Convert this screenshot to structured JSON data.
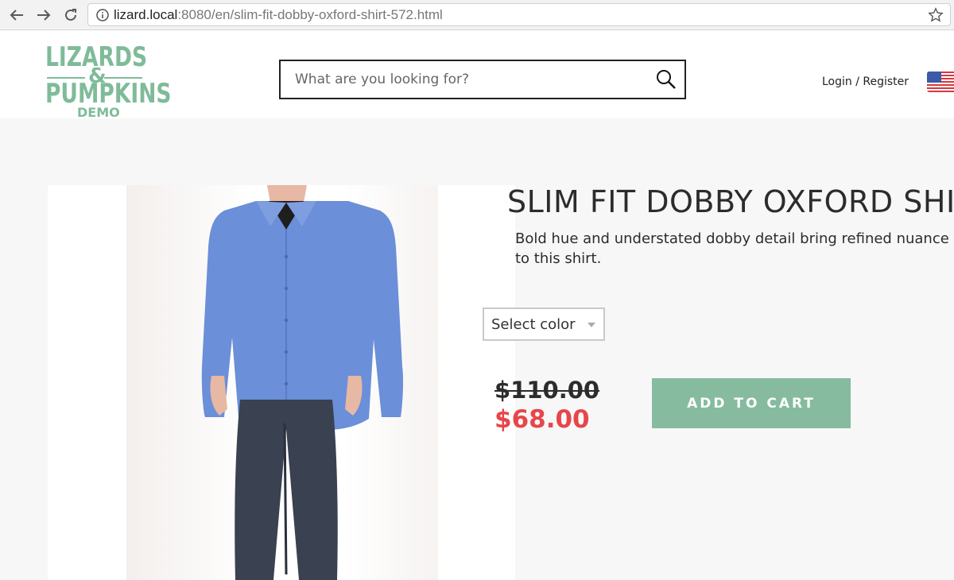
{
  "browser": {
    "url_host": "lizard.local",
    "url_rest": ":8080/en/slim-fit-dobby-oxford-shirt-572.html"
  },
  "header": {
    "logo": {
      "line1": "LIZARDS",
      "amp": "&",
      "line2": "PUMPKINS",
      "line3": "DEMO"
    },
    "search": {
      "placeholder": "What are you looking for?"
    },
    "login_label": "Login / Register",
    "flag_icon": "us-flag-icon"
  },
  "product": {
    "title": "SLIM FIT DOBBY OXFORD SHIRT",
    "description": "Bold hue and understated dobby detail bring refined nuance to this shirt.",
    "color_select": {
      "selected": "Select color"
    },
    "old_price": "$110.00",
    "new_price": "$68.00",
    "add_to_cart_label": "ADD TO CART"
  },
  "colors": {
    "accent": "#86bb9f",
    "sale_price": "#e8454a",
    "logo": "#7fbb99"
  }
}
